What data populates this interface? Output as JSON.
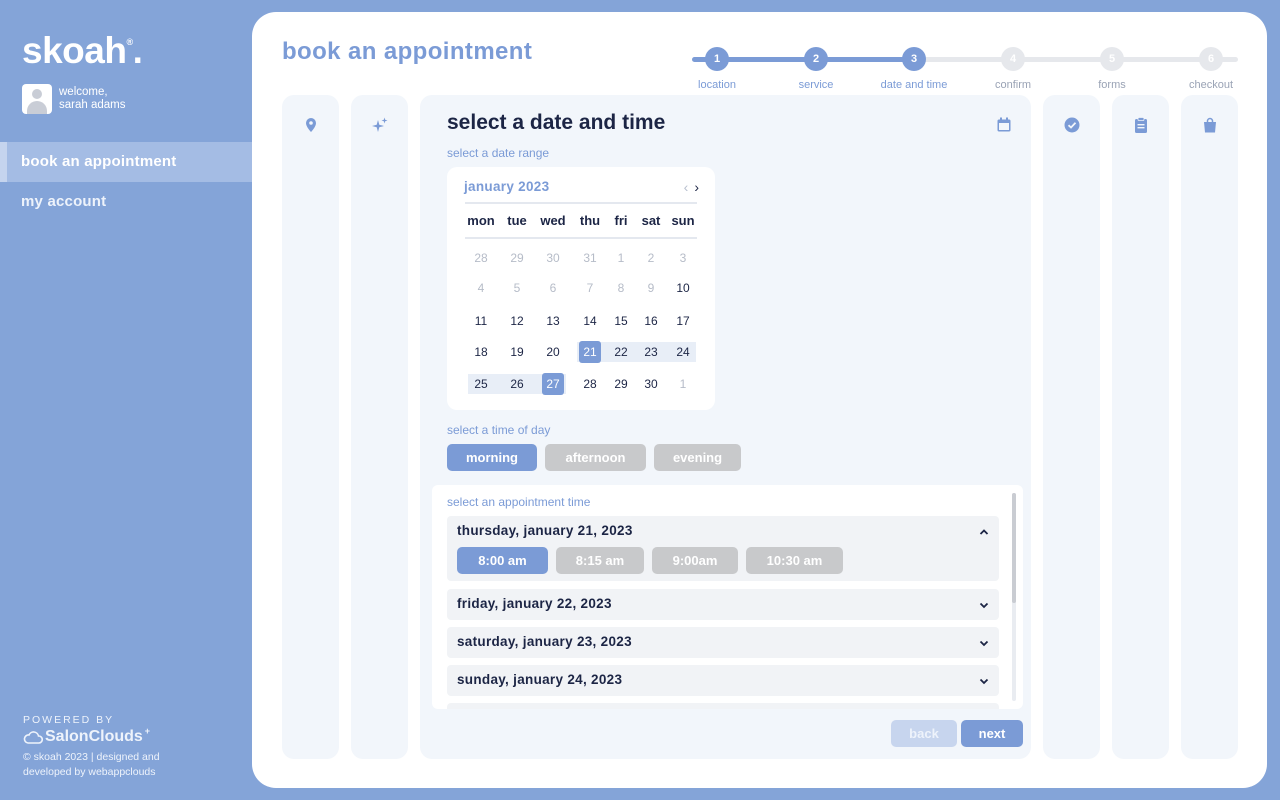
{
  "sidebar": {
    "logo": "skoah",
    "logo_mark": "®",
    "welcome": "welcome,",
    "user_name": "sarah adams",
    "nav": [
      {
        "label": "book an appointment",
        "active": true
      },
      {
        "label": "my account",
        "active": false
      }
    ],
    "powered_by": "POWERED BY",
    "powered_brand": "SalonClouds",
    "powered_brand_mark": "+",
    "copyright": "© skoah 2023 | designed and developed by webappclouds"
  },
  "header": {
    "title": "book an appointment"
  },
  "stepper": {
    "current": 3,
    "steps": [
      {
        "num": "1",
        "label": "location"
      },
      {
        "num": "2",
        "label": "service"
      },
      {
        "num": "3",
        "label": "date and time"
      },
      {
        "num": "4",
        "label": "confirm"
      },
      {
        "num": "5",
        "label": "forms"
      },
      {
        "num": "6",
        "label": "checkout"
      }
    ]
  },
  "panel_icons": {
    "left": [
      "location-pin-icon",
      "sparkle-icon"
    ],
    "right": [
      "check-circle-icon",
      "clipboard-icon",
      "shopping-bag-icon"
    ]
  },
  "main": {
    "title": "select a date and time",
    "date_range_hint": "select a date range",
    "time_of_day_hint": "select a time of day",
    "appointment_hint": "select an appointment time"
  },
  "calendar": {
    "month": "january 2023",
    "prev": "‹",
    "next": "›",
    "weekdays": [
      "mon",
      "tue",
      "wed",
      "thu",
      "fri",
      "sat",
      "sun"
    ],
    "weeks": [
      [
        {
          "d": "28",
          "m": true
        },
        {
          "d": "29",
          "m": true
        },
        {
          "d": "30",
          "m": true
        },
        {
          "d": "31",
          "m": true
        },
        {
          "d": "1",
          "m": true
        },
        {
          "d": "2",
          "m": true
        },
        {
          "d": "3",
          "m": true
        }
      ],
      [
        {
          "d": "4",
          "m": true
        },
        {
          "d": "5",
          "m": true
        },
        {
          "d": "6",
          "m": true
        },
        {
          "d": "7",
          "m": true
        },
        {
          "d": "8",
          "m": true
        },
        {
          "d": "9",
          "m": true
        },
        {
          "d": "10"
        }
      ],
      [
        {
          "d": "11"
        },
        {
          "d": "12"
        },
        {
          "d": "13"
        },
        {
          "d": "14"
        },
        {
          "d": "15"
        },
        {
          "d": "16"
        },
        {
          "d": "17"
        }
      ],
      [
        {
          "d": "18"
        },
        {
          "d": "19"
        },
        {
          "d": "20"
        },
        {
          "d": "21",
          "s": true
        },
        {
          "d": "22",
          "r": true
        },
        {
          "d": "23",
          "r": true
        },
        {
          "d": "24",
          "r": true
        }
      ],
      [
        {
          "d": "25",
          "r": true
        },
        {
          "d": "26",
          "r": true
        },
        {
          "d": "27",
          "s": true
        },
        {
          "d": "28"
        },
        {
          "d": "29"
        },
        {
          "d": "30"
        },
        {
          "d": "1",
          "m": true
        }
      ]
    ]
  },
  "time_of_day": [
    {
      "label": "morning",
      "selected": true
    },
    {
      "label": "afternoon",
      "selected": false
    },
    {
      "label": "evening",
      "selected": false
    }
  ],
  "appointments": [
    {
      "date": "thursday, january 21, 2023",
      "expanded": true,
      "slots": [
        {
          "label": "8:00 am",
          "selected": true
        },
        {
          "label": "8:15 am",
          "selected": false
        },
        {
          "label": "9:00am",
          "selected": false
        },
        {
          "label": "10:30 am",
          "selected": false
        }
      ]
    },
    {
      "date": "friday, january 22, 2023",
      "expanded": false
    },
    {
      "date": "saturday, january 23, 2023",
      "expanded": false
    },
    {
      "date": "sunday, january 24, 2023",
      "expanded": false
    }
  ],
  "buttons": {
    "back": "back",
    "next": "next"
  },
  "colors": {
    "accent": "#7b9bd6",
    "background": "#84a4d8",
    "muted_button": "#c8c9cb",
    "text": "#1c2545"
  }
}
